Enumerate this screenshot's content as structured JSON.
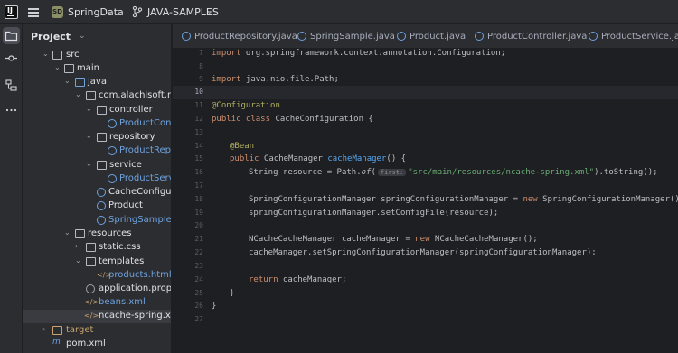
{
  "titlebar": {
    "project_badge": "SD",
    "project_name": "SpringData",
    "branch_name": "JAVA-SAMPLES"
  },
  "toolstrip": {
    "items": [
      "folder-icon",
      "commit-icon",
      "structure-icon",
      "more-icon"
    ]
  },
  "project_panel": {
    "title": "Project",
    "tree": [
      {
        "label": "src"
      },
      {
        "label": "main"
      },
      {
        "label": "java"
      },
      {
        "label": "com.alachisoft.ncach"
      },
      {
        "label": "controller"
      },
      {
        "label": "ProductContro"
      },
      {
        "label": "repository"
      },
      {
        "label": "ProductReposi"
      },
      {
        "label": "service"
      },
      {
        "label": "ProductService"
      },
      {
        "label": "CacheConfigurat"
      },
      {
        "label": "Product"
      },
      {
        "label": "SpringSample"
      },
      {
        "label": "resources"
      },
      {
        "label": "static.css"
      },
      {
        "label": "templates"
      },
      {
        "label": "products.html"
      },
      {
        "label": "application.propertie"
      },
      {
        "label": "beans.xml"
      },
      {
        "label": "ncache-spring.xml"
      },
      {
        "label": "target"
      },
      {
        "label": "pom.xml"
      }
    ]
  },
  "tabs": [
    {
      "label": "ProductRepository.java"
    },
    {
      "label": "SpringSample.java"
    },
    {
      "label": "Product.java"
    },
    {
      "label": "ProductController.java"
    },
    {
      "label": "ProductService.java"
    }
  ],
  "editor": {
    "line_numbers": [
      "7",
      "8",
      "9",
      "10",
      "11",
      "12",
      "13",
      "14",
      "15",
      "16",
      "17",
      "18",
      "19",
      "20",
      "21",
      "22",
      "23",
      "24",
      "25",
      "26",
      "27"
    ],
    "current_line": "10",
    "code": {
      "l7_kw": "import",
      "l7_rest": " org.springframework.context.annotation.Configuration;",
      "l9_kw": "import",
      "l9_rest": " java.nio.file.Path;",
      "l11": "@Configuration",
      "l12_kw": "public class",
      "l12_rest": " CacheConfiguration {",
      "l14": "@Bean",
      "l15_kw": "public",
      "l15_type": " CacheManager ",
      "l15_fn": "cacheManager",
      "l15_rest": "() {",
      "l16_a": "String resource = Path.",
      "l16_fn": "of",
      "l16_b": "(",
      "l16_hint": "first:",
      "l16_str": "\"src/main/resources/ncache-spring.xml\"",
      "l16_c": ").toString();",
      "l18_a": "SpringConfigurationManager springConfigurationManager = ",
      "l18_kw": "new",
      "l18_b": " SpringConfigurationManager();",
      "l19": "springConfigurationManager.setConfigFile(resource);",
      "l21_a": "NCacheCacheManager cacheManager = ",
      "l21_kw": "new",
      "l21_b": " NCacheCacheManager();",
      "l22": "cacheManager.setSpringConfigurationManager(springConfigurationManager);",
      "l24_kw": "return",
      "l24_rest": " cacheManager;",
      "l25": "}",
      "l26": "}"
    }
  },
  "colors": {
    "background": "#1e1f22",
    "panel": "#2b2d30",
    "keyword": "#cf8e6d",
    "annotation": "#b3ae60",
    "function": "#56a8f5",
    "string": "#6aab73"
  }
}
